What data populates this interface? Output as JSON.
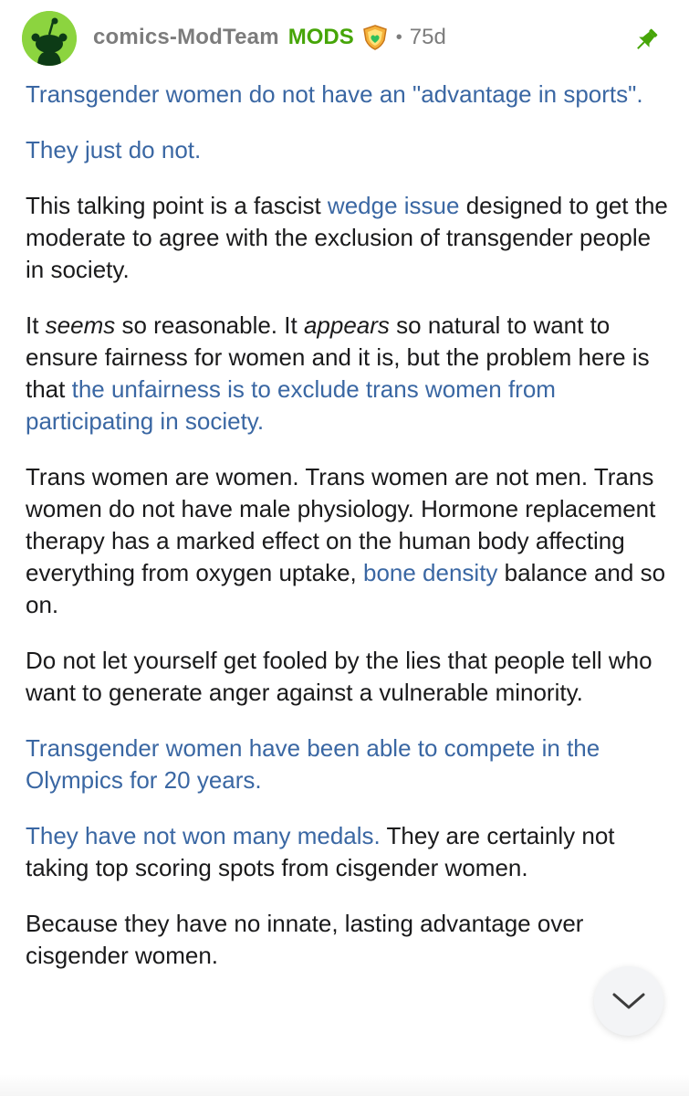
{
  "header": {
    "username": "comics-ModTeam",
    "role_badge": "MODS",
    "separator": "•",
    "age": "75d",
    "icons": {
      "avatar": "reddit-snoo-avatar-icon",
      "shield": "mod-shield-icon",
      "pin": "pin-icon"
    },
    "colors": {
      "avatar_bg": "#8cd43f",
      "mods_green": "#46a508",
      "pin_green": "#46a508",
      "link_blue": "#3a67a3"
    }
  },
  "comment": {
    "p1": "Transgender women do not have an \"advantage in sports\".",
    "p2": "They just do not.",
    "p3_a": "This talking point is a fascist ",
    "p3_link": "wedge issue",
    "p3_b": " designed to get the moderate to agree with the exclusion of transgender people in society.",
    "p4_a": "It ",
    "p4_em1": "seems",
    "p4_b": " so reasonable. It ",
    "p4_em2": "appears",
    "p4_c": " so natural to want to ensure fairness for women and it is, but the problem here is that ",
    "p4_link": "the unfairness is to exclude trans women from participating in society.",
    "p5_a": "Trans women are women. Trans women are not men. Trans women do not have male physiology. Hormone replacement therapy has a marked effect on the human body affecting everything from oxygen uptake, ",
    "p5_link": "bone density",
    "p5_b": " balance and so on.",
    "p6": "Do not let yourself get fooled by the lies that people tell who want to generate anger against a vulnerable minority.",
    "p7": "Transgender women have been able to compete in the Olympics for 20 years.",
    "p8_link": "They have not won many medals.",
    "p8_b": " They are certainly not taking top scoring spots from cisgender women.",
    "p9": "Because they have no innate, lasting advantage over cisgender women."
  },
  "scroll_button": {
    "icon": "chevron-down-icon"
  }
}
